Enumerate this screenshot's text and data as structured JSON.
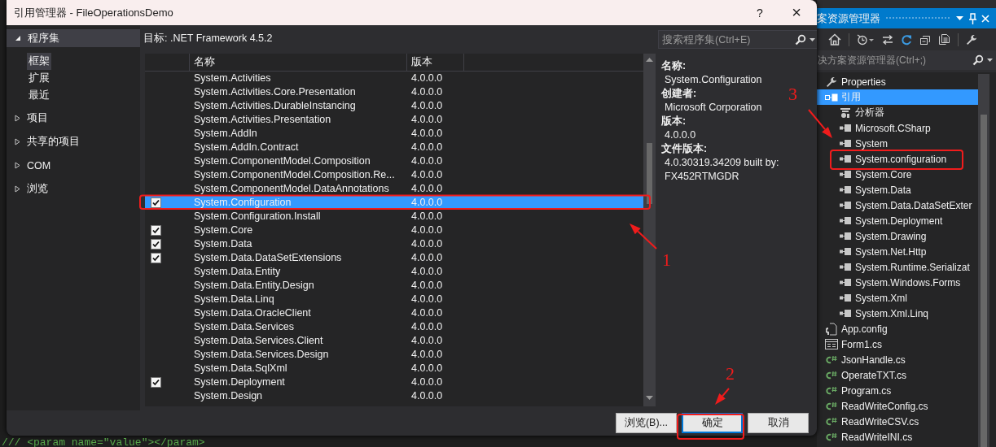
{
  "editor": {
    "code_line": "/// <param name=\"value\"></param>"
  },
  "dialog": {
    "title": "引用管理器 - FileOperationsDemo",
    "help_button": "?",
    "close_button": "×",
    "nav": [
      {
        "label": "程序集",
        "expanded": true,
        "children": [
          {
            "label": "框架",
            "selected": true
          },
          {
            "label": "扩展",
            "selected": false
          },
          {
            "label": "最近",
            "selected": false
          }
        ]
      },
      {
        "label": "项目",
        "expanded": false
      },
      {
        "label": "共享的项目",
        "expanded": false
      },
      {
        "label": "COM",
        "expanded": false
      },
      {
        "label": "浏览",
        "expanded": false
      }
    ],
    "target": "目标: .NET Framework 4.5.2",
    "search": {
      "placeholder": "搜索程序集(Ctrl+E)"
    },
    "table": {
      "columns": [
        "名称",
        "版本"
      ],
      "rows": [
        {
          "name": "System.Activities",
          "version": "4.0.0.0",
          "checked": false,
          "selected": false
        },
        {
          "name": "System.Activities.Core.Presentation",
          "version": "4.0.0.0",
          "checked": false,
          "selected": false
        },
        {
          "name": "System.Activities.DurableInstancing",
          "version": "4.0.0.0",
          "checked": false,
          "selected": false
        },
        {
          "name": "System.Activities.Presentation",
          "version": "4.0.0.0",
          "checked": false,
          "selected": false
        },
        {
          "name": "System.AddIn",
          "version": "4.0.0.0",
          "checked": false,
          "selected": false
        },
        {
          "name": "System.AddIn.Contract",
          "version": "4.0.0.0",
          "checked": false,
          "selected": false
        },
        {
          "name": "System.ComponentModel.Composition",
          "version": "4.0.0.0",
          "checked": false,
          "selected": false
        },
        {
          "name": "System.ComponentModel.Composition.Re...",
          "version": "4.0.0.0",
          "checked": false,
          "selected": false
        },
        {
          "name": "System.ComponentModel.DataAnnotations",
          "version": "4.0.0.0",
          "checked": false,
          "selected": false
        },
        {
          "name": "System.Configuration",
          "version": "4.0.0.0",
          "checked": true,
          "selected": true
        },
        {
          "name": "System.Configuration.Install",
          "version": "4.0.0.0",
          "checked": false,
          "selected": false
        },
        {
          "name": "System.Core",
          "version": "4.0.0.0",
          "checked": true,
          "selected": false
        },
        {
          "name": "System.Data",
          "version": "4.0.0.0",
          "checked": true,
          "selected": false
        },
        {
          "name": "System.Data.DataSetExtensions",
          "version": "4.0.0.0",
          "checked": true,
          "selected": false
        },
        {
          "name": "System.Data.Entity",
          "version": "4.0.0.0",
          "checked": false,
          "selected": false
        },
        {
          "name": "System.Data.Entity.Design",
          "version": "4.0.0.0",
          "checked": false,
          "selected": false
        },
        {
          "name": "System.Data.Linq",
          "version": "4.0.0.0",
          "checked": false,
          "selected": false
        },
        {
          "name": "System.Data.OracleClient",
          "version": "4.0.0.0",
          "checked": false,
          "selected": false
        },
        {
          "name": "System.Data.Services",
          "version": "4.0.0.0",
          "checked": false,
          "selected": false
        },
        {
          "name": "System.Data.Services.Client",
          "version": "4.0.0.0",
          "checked": false,
          "selected": false
        },
        {
          "name": "System.Data.Services.Design",
          "version": "4.0.0.0",
          "checked": false,
          "selected": false
        },
        {
          "name": "System.Data.SqlXml",
          "version": "4.0.0.0",
          "checked": false,
          "selected": false
        },
        {
          "name": "System.Deployment",
          "version": "4.0.0.0",
          "checked": true,
          "selected": false
        },
        {
          "name": "System.Design",
          "version": "4.0.0.0",
          "checked": false,
          "selected": false
        }
      ]
    },
    "details": [
      {
        "label": "名称:",
        "value_lines": [
          "System.Configuration"
        ]
      },
      {
        "label": "创建者:",
        "value_lines": [
          "Microsoft Corporation"
        ]
      },
      {
        "label": "版本:",
        "value_lines": [
          "4.0.0.0"
        ]
      },
      {
        "label": "文件版本:",
        "value_lines": [
          "4.0.30319.34209 built by:",
          "FX452RTMGDR"
        ]
      }
    ],
    "buttons": [
      {
        "label": "浏览(B)...",
        "default": false
      },
      {
        "label": "确定",
        "default": true
      },
      {
        "label": "取消",
        "default": false
      }
    ]
  },
  "solution_explorer": {
    "title": "案资源管理器",
    "search": {
      "placeholder": "决方案资源管理器(Ctrl+;)"
    },
    "tree": [
      {
        "label": "Properties",
        "kind": "properties",
        "selected": false
      },
      {
        "label": "引用",
        "kind": "references",
        "selected": true,
        "children": [
          {
            "label": "分析器",
            "kind": "analyzer",
            "selected": false
          },
          {
            "label": "Microsoft.CSharp",
            "kind": "assembly",
            "selected": false
          },
          {
            "label": "System",
            "kind": "assembly",
            "selected": false
          },
          {
            "label": "System.configuration",
            "kind": "assembly",
            "selected": false
          },
          {
            "label": "System.Core",
            "kind": "assembly",
            "selected": false
          },
          {
            "label": "System.Data",
            "kind": "assembly",
            "selected": false
          },
          {
            "label": "System.Data.DataSetExter",
            "kind": "assembly",
            "selected": false
          },
          {
            "label": "System.Deployment",
            "kind": "assembly",
            "selected": false
          },
          {
            "label": "System.Drawing",
            "kind": "assembly",
            "selected": false
          },
          {
            "label": "System.Net.Http",
            "kind": "assembly",
            "selected": false
          },
          {
            "label": "System.Runtime.Serializat",
            "kind": "assembly",
            "selected": false
          },
          {
            "label": "System.Windows.Forms",
            "kind": "assembly",
            "selected": false
          },
          {
            "label": "System.Xml",
            "kind": "assembly",
            "selected": false
          },
          {
            "label": "System.Xml.Linq",
            "kind": "assembly",
            "selected": false
          }
        ]
      },
      {
        "label": "App.config",
        "kind": "config",
        "selected": false
      },
      {
        "label": "Form1.cs",
        "kind": "form",
        "selected": false
      },
      {
        "label": "JsonHandle.cs",
        "kind": "csharp",
        "selected": false
      },
      {
        "label": "OperateTXT.cs",
        "kind": "csharp",
        "selected": false
      },
      {
        "label": "Program.cs",
        "kind": "csharp",
        "selected": false
      },
      {
        "label": "ReadWriteConfig.cs",
        "kind": "csharp",
        "selected": false
      },
      {
        "label": "ReadWriteCSV.cs",
        "kind": "csharp",
        "selected": false
      },
      {
        "label": "ReadWriteINI.cs",
        "kind": "csharp",
        "selected": false
      }
    ]
  },
  "annotations": [
    {
      "label": "1"
    },
    {
      "label": "2"
    },
    {
      "label": "3"
    }
  ]
}
